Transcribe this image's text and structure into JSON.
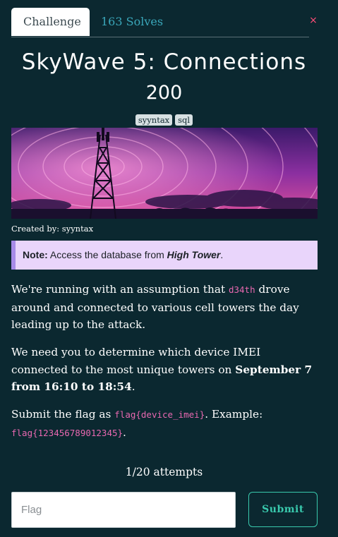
{
  "tabs": {
    "challenge": "Challenge",
    "solves": "163 Solves"
  },
  "close_icon": "×",
  "challenge": {
    "title": "SkyWave 5: Connections",
    "value": "200",
    "tags": [
      "syyntax",
      "sql"
    ],
    "created_by": "Created by: syyntax"
  },
  "note": {
    "label": "Note:",
    "text": "Access the database from",
    "target": "High Tower",
    "end": "."
  },
  "description": {
    "p1": {
      "a": "We're running with an assumption that",
      "code": "d34th",
      "b": "drove around and connected to various cell towers the day leading up to the attack."
    },
    "p2": {
      "a": "We need you to determine which device IMEI connected to the most unique towers on",
      "strong": "September 7 from 16:10 to 18:54",
      "b": "."
    },
    "p3": {
      "a": "Submit the flag as",
      "code1": "flag{device_imei}",
      "b": ". Example:",
      "code2": "flag{123456789012345}",
      "c": "."
    }
  },
  "attempts": "1/20 attempts",
  "form": {
    "placeholder": "Flag",
    "submit": "Submit"
  },
  "colors": {
    "background": "#0b2830",
    "accent": "#39c9ad",
    "tab_link": "#3aa7ba",
    "code": "#e868b0",
    "note_bg": "#e9d5fb",
    "close": "#ff4d78"
  }
}
